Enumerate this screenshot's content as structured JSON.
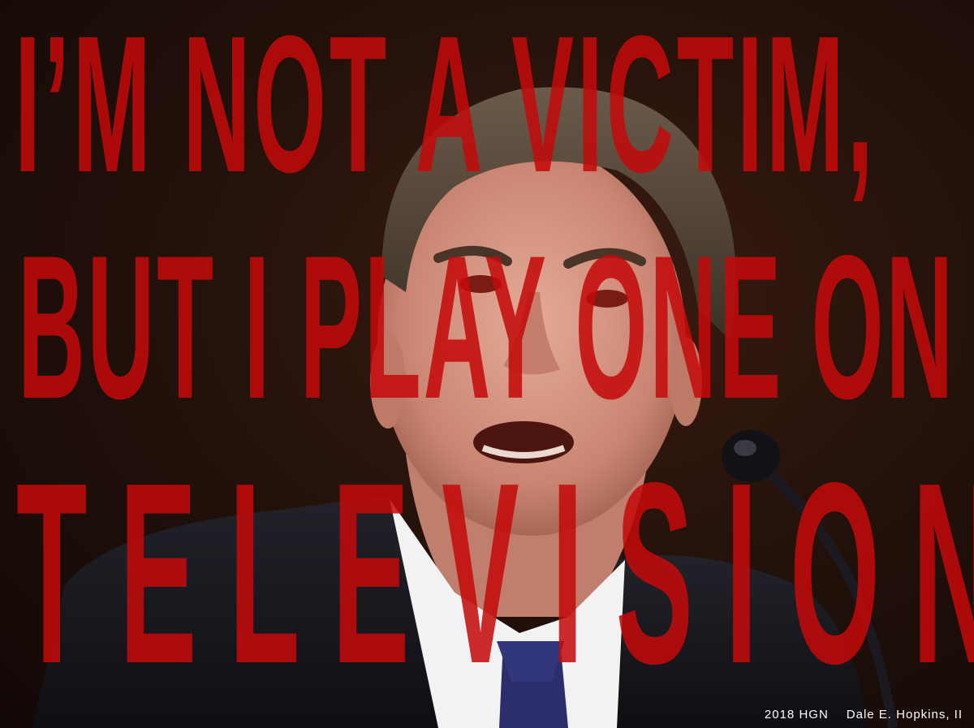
{
  "headline": {
    "line1": "I’M NOT  A VICTIM,",
    "line2": "BUT I PLAY ONE ON",
    "line3": "TELEVISION"
  },
  "credit": {
    "year_org": "2018 HGN",
    "author": "Dale E. Hopkins, II"
  },
  "colors": {
    "text_red": "#c40a0a",
    "background": "#24120b",
    "suit": "#15151c",
    "tie": "#2b2e6a",
    "skin": "#d99a86"
  },
  "icons": {
    "microphone": "microphone-icon"
  }
}
